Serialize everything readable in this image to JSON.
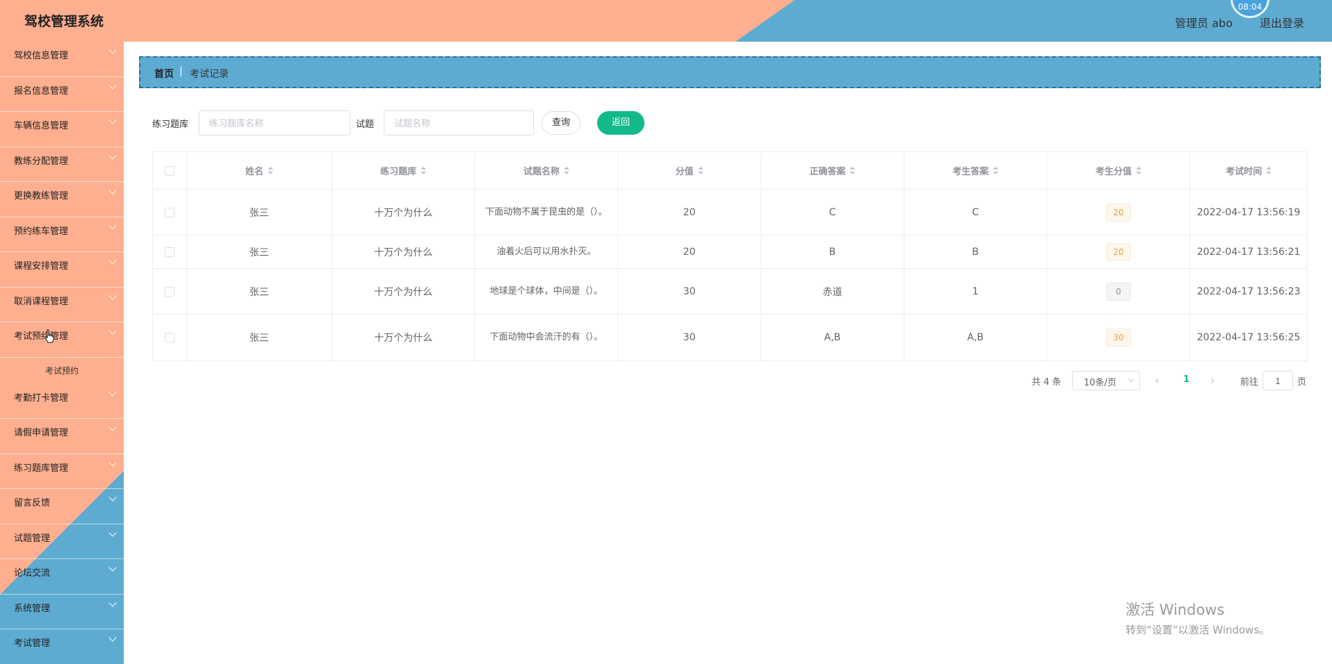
{
  "header": {
    "title": "驾校管理系统",
    "clock": "08:04",
    "user": "管理员 abo",
    "logout": "退出登录",
    "colors": {
      "salmon": "#fdaf8f",
      "blue": "#5eabd2"
    }
  },
  "sidebar": {
    "items": [
      {
        "label": "驾校信息管理"
      },
      {
        "label": "报名信息管理"
      },
      {
        "label": "车辆信息管理"
      },
      {
        "label": "教练分配管理"
      },
      {
        "label": "更换教练管理"
      },
      {
        "label": "预约练车管理"
      },
      {
        "label": "课程安排管理"
      },
      {
        "label": "取消课程管理"
      },
      {
        "label": "考试预约管理",
        "expanded": true,
        "children": [
          {
            "label": "考试预约"
          }
        ]
      },
      {
        "label": "考勤打卡管理"
      },
      {
        "label": "请假申请管理"
      },
      {
        "label": "练习题库管理"
      },
      {
        "label": "留言反馈"
      },
      {
        "label": "试题管理"
      },
      {
        "label": "论坛交流"
      },
      {
        "label": "系统管理"
      },
      {
        "label": "考试管理"
      }
    ]
  },
  "breadcrumb": {
    "home": "首页",
    "separator": "|",
    "current": "考试记录"
  },
  "search": {
    "bank_label": "练习题库",
    "bank_placeholder": "练习题库名称",
    "question_label": "试题",
    "question_placeholder": "试题名称",
    "query_button": "查询",
    "back_button": "返回",
    "accent": "#14b98a"
  },
  "table": {
    "columns": [
      "姓名",
      "练习题库",
      "试题名称",
      "分值",
      "正确答案",
      "考生答案",
      "考生分值",
      "考试时间"
    ],
    "rows": [
      {
        "name": "张三",
        "bank": "十万个为什么",
        "question": "下面动物不属于昆虫的是（）。",
        "score": "20",
        "correct": "C",
        "answer": "C",
        "got": "20",
        "time": "2022-04-17 13:56:19"
      },
      {
        "name": "张三",
        "bank": "十万个为什么",
        "question": "油着火后可以用水扑灭。",
        "score": "20",
        "correct": "B",
        "answer": "B",
        "got": "20",
        "time": "2022-04-17 13:56:21"
      },
      {
        "name": "张三",
        "bank": "十万个为什么",
        "question": "地球是个球体，中间是（）。",
        "score": "30",
        "correct": "赤道",
        "answer": "1",
        "got": "0",
        "time": "2022-04-17 13:56:23"
      },
      {
        "name": "张三",
        "bank": "十万个为什么",
        "question": "下面动物中会流汗的有（）。",
        "score": "30",
        "correct": "A,B",
        "answer": "A,B",
        "got": "30",
        "time": "2022-04-17 13:56:25"
      }
    ]
  },
  "pagination": {
    "total": "共 4 条",
    "page_size": "10条/页",
    "current_page": "1",
    "goto_label": "前往",
    "goto_value": "1",
    "goto_unit": "页"
  },
  "watermark": {
    "line1": "激活 Windows",
    "line2": "转到“设置”以激活 Windows。"
  }
}
